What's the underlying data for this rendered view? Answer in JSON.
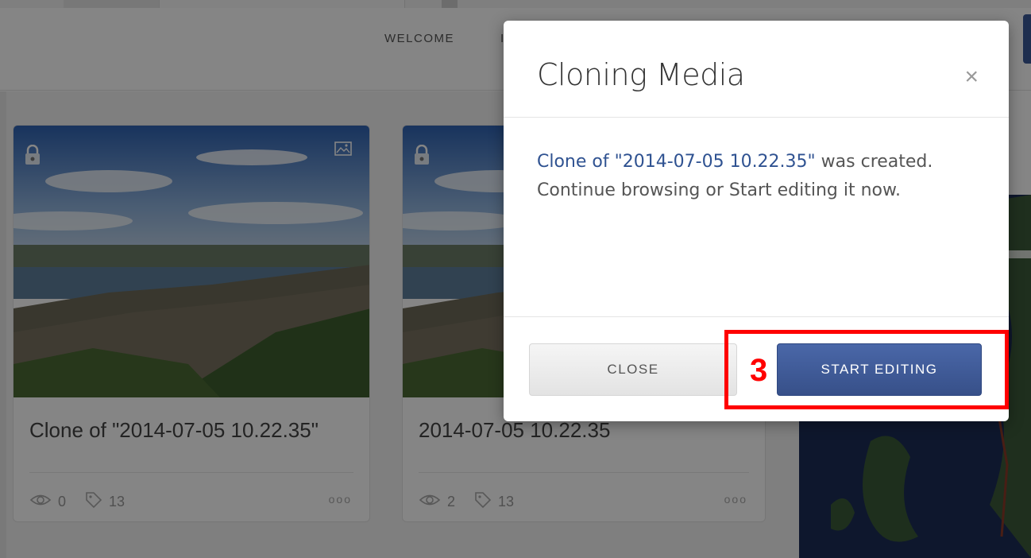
{
  "nav": {
    "welcome": "WELCOME",
    "next_partial": "I"
  },
  "cards": [
    {
      "title": "Clone of \"2014-07-05 10.22.35\"",
      "views": "0",
      "tags": "13",
      "more": "ooo",
      "locked": true,
      "has_image_icon": true
    },
    {
      "title": "2014-07-05 10.22.35",
      "views": "2",
      "tags": "13",
      "more": "ooo",
      "locked": true,
      "has_image_icon": false
    }
  ],
  "modal": {
    "title": "Cloning Media",
    "close_glyph": "×",
    "message_link": "Clone of \"2014-07-05 10.22.35\"",
    "message_rest": " was created. Continue browsing or Start editing it now.",
    "close_label": "CLOSE",
    "start_label": "START EDITING"
  },
  "annotation": {
    "number": "3",
    "color": "#ff0000"
  },
  "colors": {
    "primary": "#3b5998",
    "overlay": "rgba(0,0,0,0.48)",
    "annotation": "#ff0000"
  },
  "icons": [
    "lock-icon",
    "image-icon",
    "eye-icon",
    "tag-icon",
    "close-icon",
    "more-icon"
  ]
}
